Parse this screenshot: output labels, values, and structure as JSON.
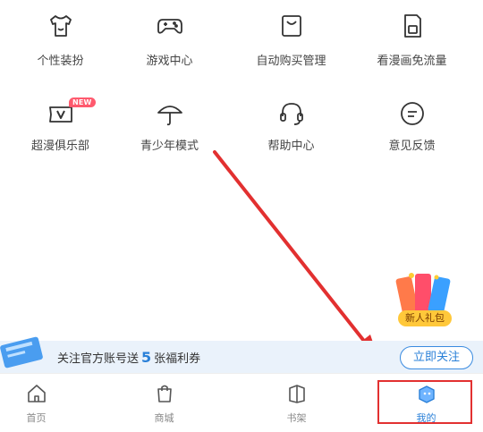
{
  "menu": {
    "row1": [
      {
        "label": "个性装扮",
        "icon": "tshirt-icon"
      },
      {
        "label": "游戏中心",
        "icon": "gamepad-icon"
      },
      {
        "label": "自动购买管理",
        "icon": "shopping-bag-icon"
      },
      {
        "label": "看漫画免流量",
        "icon": "sim-card-icon"
      }
    ],
    "row2": [
      {
        "label": "超漫俱乐部",
        "icon": "vip-card-icon",
        "badge": "NEW"
      },
      {
        "label": "青少年模式",
        "icon": "umbrella-icon"
      },
      {
        "label": "帮助中心",
        "icon": "headset-icon"
      },
      {
        "label": "意见反馈",
        "icon": "feedback-icon"
      }
    ]
  },
  "gift": {
    "label": "新人礼包"
  },
  "banner": {
    "text_before": "关注官方账号送",
    "count": "5",
    "text_after": "张福利券",
    "button": "立即关注"
  },
  "tabbar": [
    {
      "label": "首页",
      "icon": "home-icon"
    },
    {
      "label": "商城",
      "icon": "shopping-bag-icon"
    },
    {
      "label": "书架",
      "icon": "books-icon"
    },
    {
      "label": "我的",
      "icon": "profile-icon",
      "active": true
    }
  ],
  "colors": {
    "accent": "#2a80d8",
    "annotation": "#e23030",
    "badge": "#ff5a6e",
    "banner_bg": "#eaf2fb"
  }
}
